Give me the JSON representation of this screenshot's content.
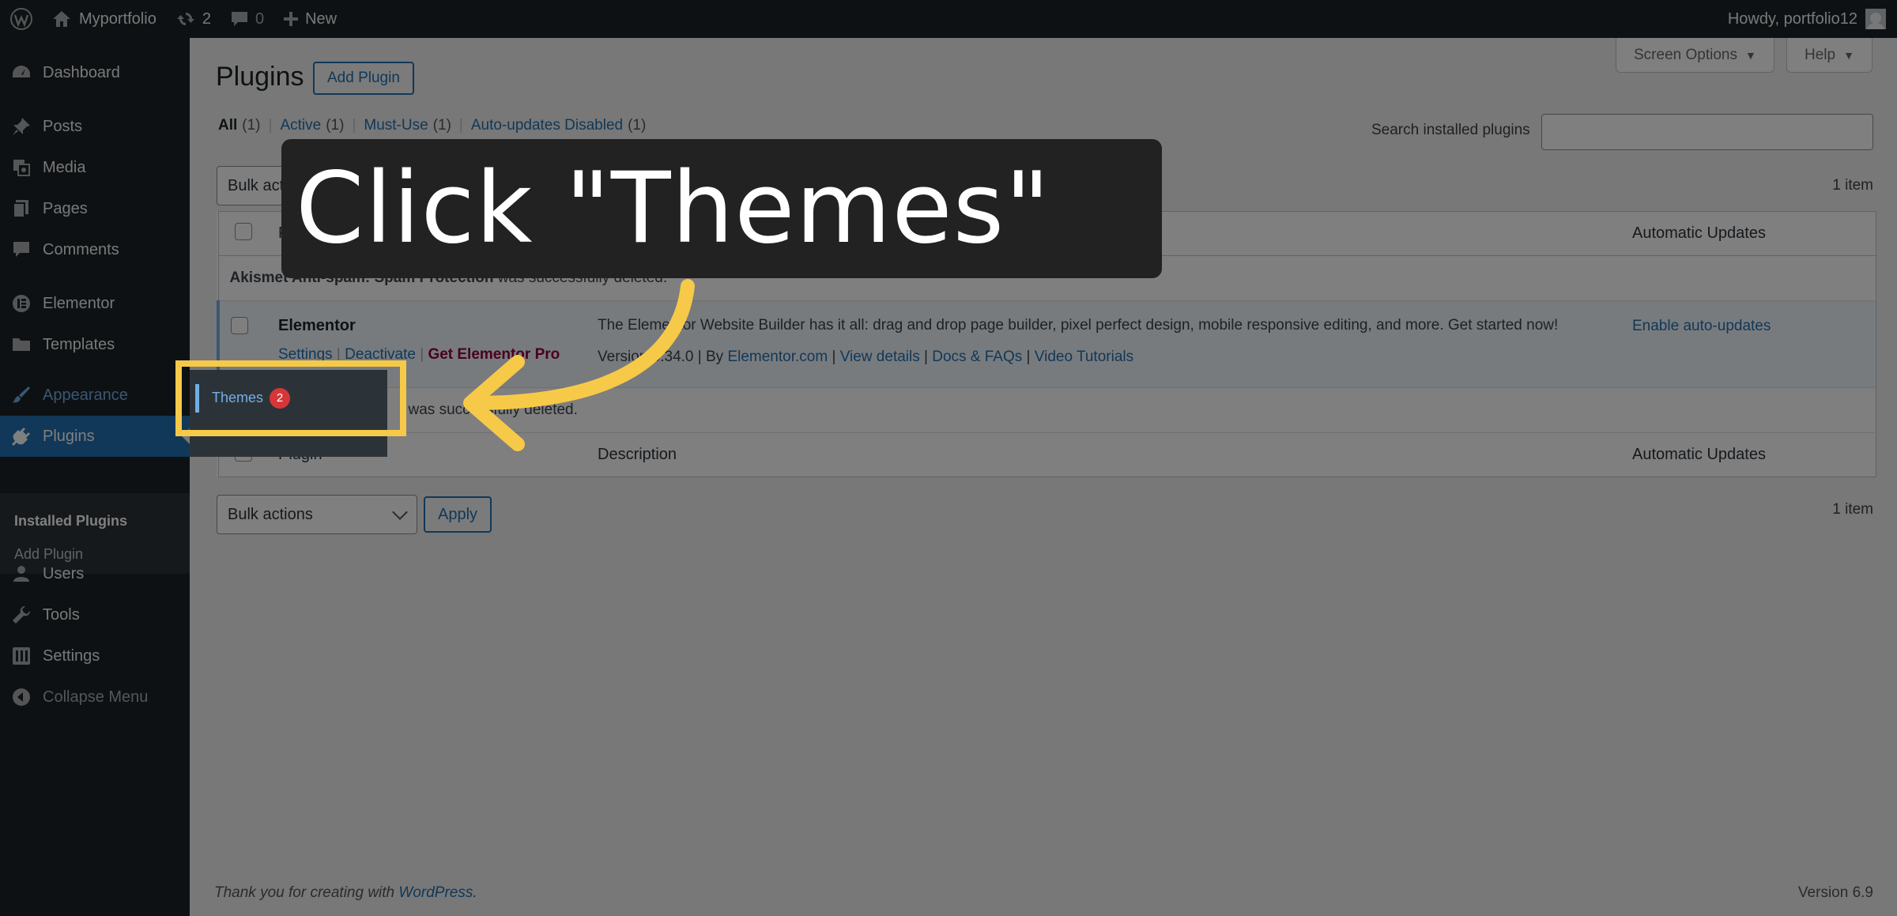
{
  "adminbar": {
    "site_name": "Myportfolio",
    "updates_count": "2",
    "comments_count": "0",
    "new_label": "New",
    "howdy": "Howdy, portfolio12"
  },
  "sidebar": {
    "items": [
      {
        "label": "Dashboard",
        "icon": "dashboard-icon"
      },
      {
        "label": "Posts",
        "icon": "pin-icon"
      },
      {
        "label": "Media",
        "icon": "media-icon"
      },
      {
        "label": "Pages",
        "icon": "pages-icon"
      },
      {
        "label": "Comments",
        "icon": "comment-icon"
      },
      {
        "label": "Elementor",
        "icon": "elementor-icon"
      },
      {
        "label": "Templates",
        "icon": "folder-icon"
      },
      {
        "label": "Appearance",
        "icon": "brush-icon"
      },
      {
        "label": "Plugins",
        "icon": "plugin-icon"
      },
      {
        "label": "Users",
        "icon": "users-icon"
      },
      {
        "label": "Tools",
        "icon": "wrench-icon"
      },
      {
        "label": "Settings",
        "icon": "settings-icon"
      },
      {
        "label": "Collapse Menu",
        "icon": "collapse-icon"
      }
    ],
    "plugins_submenu": [
      "Installed Plugins",
      "Add Plugin"
    ],
    "appearance_flyout": {
      "themes_label": "Themes",
      "themes_badge": "2"
    }
  },
  "screen_meta": {
    "screen_options": "Screen Options",
    "help": "Help"
  },
  "page": {
    "title": "Plugins",
    "add_button": "Add Plugin",
    "filters": [
      {
        "label": "All",
        "count": "(1)"
      },
      {
        "label": "Active",
        "count": "(1)"
      },
      {
        "label": "Must-Use",
        "count": "(1)"
      },
      {
        "label": "Auto-updates Disabled",
        "count": "(1)"
      }
    ],
    "search_label": "Search installed plugins",
    "bulk_actions": "Bulk actions",
    "apply": "Apply",
    "item_count": "1 item"
  },
  "table": {
    "headers": [
      "Plugin",
      "Description",
      "Automatic Updates"
    ],
    "notice_top": {
      "name": "Akismet Anti-spam: Spam Protection",
      "text": " was successfully deleted."
    },
    "notice_bottom": {
      "text": "was successfully deleted."
    },
    "plugin": {
      "name": "Elementor",
      "actions": [
        "Settings",
        "Deactivate",
        "Get Elementor Pro"
      ],
      "description": "The Elementor Website Builder has it all: drag and drop page builder, pixel perfect design, mobile responsive editing, and more. Get started now!",
      "version": "Version 3.34.0",
      "by": "By",
      "author": "Elementor.com",
      "links": [
        "View details",
        "Docs & FAQs",
        "Video Tutorials"
      ],
      "auto_update": "Enable auto-updates"
    }
  },
  "footer": {
    "thanks_prefix": "Thank you for creating with ",
    "thanks_link": "WordPress",
    "thanks_suffix": ".",
    "version": "Version 6.9"
  },
  "overlay": {
    "callout_text": "Click \"Themes\"",
    "highlight_color": "#f7c948"
  }
}
